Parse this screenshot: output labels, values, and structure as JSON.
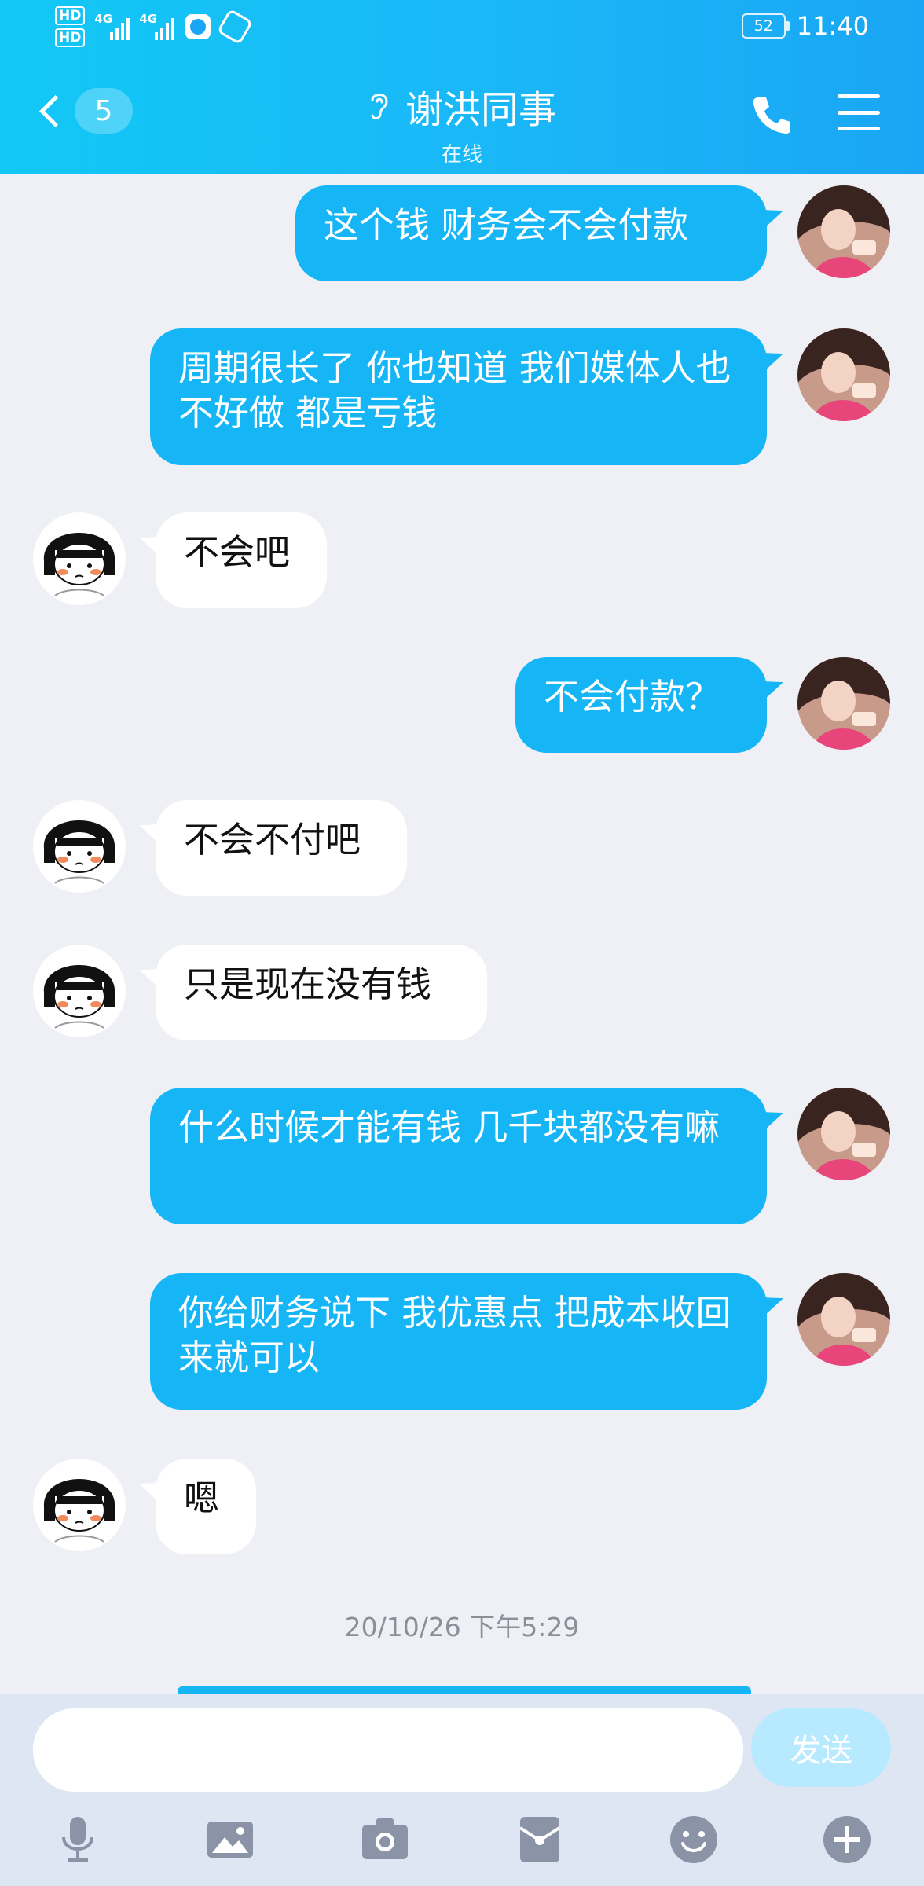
{
  "status_bar": {
    "hd_top": "HD",
    "hd_bottom": "HD",
    "signal_1": "4G",
    "signal_2": "4G",
    "battery": "52",
    "time": "11:40"
  },
  "header": {
    "back_badge": "5",
    "contact_name": "谢洪同事",
    "contact_status": "在线"
  },
  "messages": [
    {
      "side": "me",
      "text": "这个钱  财务会不会付款"
    },
    {
      "side": "me",
      "text": "周期很长了  你也知道  我们媒体人也不好做  都是亏钱"
    },
    {
      "side": "them",
      "text": "不会吧"
    },
    {
      "side": "me",
      "text": "不会付款？"
    },
    {
      "side": "them",
      "text": "不会不付吧"
    },
    {
      "side": "them",
      "text": "只是现在没有钱"
    },
    {
      "side": "me",
      "text": "什么时候才能有钱   几千块都没有嘛"
    },
    {
      "side": "me",
      "text": "你给财务说下   我优惠点  把成本收回来就可以"
    },
    {
      "side": "them",
      "text": "嗯"
    }
  ],
  "timestamp": "20/10/26 下午5:29",
  "input": {
    "placeholder": "",
    "send_label": "发送"
  },
  "toolbar": [
    "microphone-icon",
    "image-icon",
    "camera-icon",
    "red-packet-icon",
    "emoji-icon",
    "plus-icon"
  ],
  "colors": {
    "header": "#1ab7f7",
    "my_bubble": "#16b5f6",
    "their_bubble": "#ffffff",
    "background": "#eef0f6"
  }
}
